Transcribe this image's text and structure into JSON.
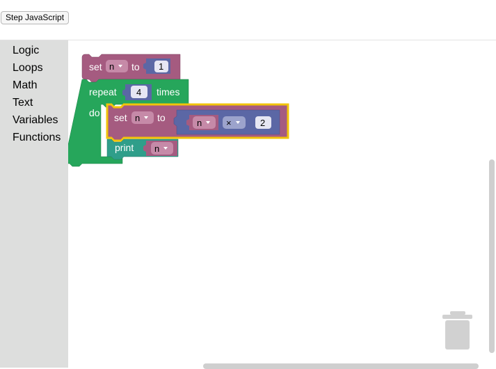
{
  "toolbar": {
    "step_label": "Step JavaScript"
  },
  "toolbox": {
    "categories": [
      {
        "label": "Logic"
      },
      {
        "label": "Loops"
      },
      {
        "label": "Math"
      },
      {
        "label": "Text"
      },
      {
        "label": "Variables"
      },
      {
        "label": "Functions"
      }
    ]
  },
  "blocks": {
    "set1": {
      "keyword": "set",
      "variable": "n",
      "to": "to",
      "value": "1"
    },
    "repeat": {
      "keyword": "repeat",
      "times_value": "4",
      "times": "times",
      "do": "do"
    },
    "set2": {
      "keyword": "set",
      "variable": "n",
      "to": "to"
    },
    "arith": {
      "left_var": "n",
      "operator": "×",
      "right_value": "2"
    },
    "print": {
      "keyword": "print",
      "variable": "n"
    }
  },
  "colors": {
    "variables_block": "#a55b80",
    "loops_block": "#26a65b",
    "math_block": "#5b67a5",
    "text_block": "#2f9e8a",
    "selected_outline": "#f2c40a",
    "dropdown_field": "#c68aa8",
    "value_field": "#e6e6f3",
    "trash": "#d1d1d1"
  }
}
